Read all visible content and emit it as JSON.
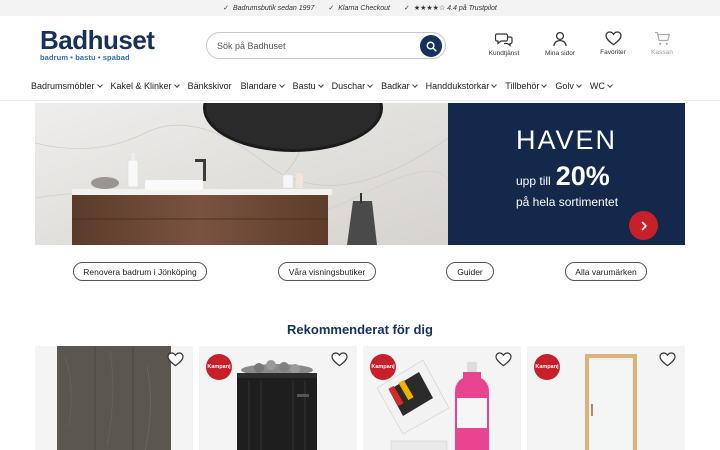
{
  "topbar": {
    "usps": [
      {
        "check": "✓",
        "text": "Badrumsbutik sedan 1997"
      },
      {
        "check": "✓",
        "text": "Klarna Checkout"
      },
      {
        "check": "✓",
        "text": "★★★★☆ 4.4 på Trustpilot"
      }
    ]
  },
  "header": {
    "logo_name": "Badhuset",
    "logo_tagline": "badrum • bastu • spabad",
    "search_placeholder": "Sök på Badhuset",
    "actions": {
      "customer_service": "Kundtjänst",
      "my_pages": "Mina sidor",
      "favorites": "Favoriter",
      "checkout": "Kassan"
    }
  },
  "nav": {
    "items": [
      {
        "label": "Badrumsmöbler",
        "dropdown": true
      },
      {
        "label": "Kakel & Klinker",
        "dropdown": true
      },
      {
        "label": "Bänkskivor",
        "dropdown": false
      },
      {
        "label": "Blandare",
        "dropdown": true
      },
      {
        "label": "Bastu",
        "dropdown": true
      },
      {
        "label": "Duschar",
        "dropdown": true
      },
      {
        "label": "Badkar",
        "dropdown": true
      },
      {
        "label": "Handdukstorkar",
        "dropdown": true
      },
      {
        "label": "Tillbehör",
        "dropdown": true
      },
      {
        "label": "Golv",
        "dropdown": true
      },
      {
        "label": "WC",
        "dropdown": true
      }
    ]
  },
  "hero": {
    "title": "HAVEN",
    "prefix": "upp till",
    "percent": "20%",
    "subtitle": "på hela sortimentet"
  },
  "links": {
    "renovate": "Renovera badrum i Jönköping",
    "showrooms": "Våra visningsbutiker",
    "guides": "Guider",
    "brands": "Alla varumärken"
  },
  "recommended": {
    "title": "Rekommenderat för dig",
    "products": [
      {
        "badge": ""
      },
      {
        "badge": "Kampanj"
      },
      {
        "badge": "Kampanj"
      },
      {
        "badge": "Kampanj"
      }
    ]
  },
  "colors": {
    "brand_navy": "#16315a",
    "hero_navy": "#13284a",
    "accent_red": "#c8202a",
    "logo_blue": "#2b6cb0"
  }
}
